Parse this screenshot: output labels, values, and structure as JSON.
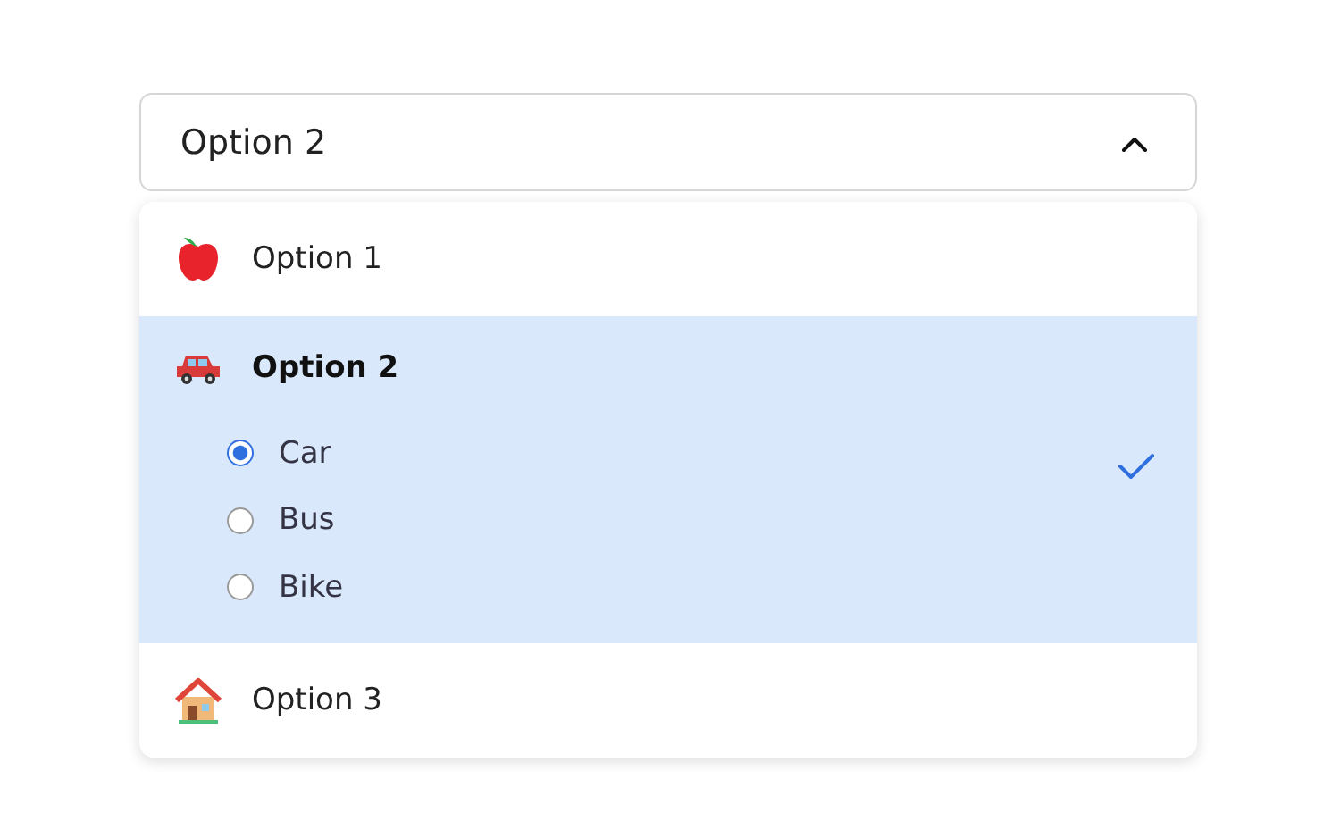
{
  "select": {
    "value": "Option 2",
    "expanded": true
  },
  "options": [
    {
      "label": "Option 1",
      "kind": "apple",
      "selected": false
    },
    {
      "label": "Option 2",
      "kind": "car",
      "selected": true,
      "choices": [
        {
          "label": "Car",
          "selected": true
        },
        {
          "label": "Bus",
          "selected": false
        },
        {
          "label": "Bike",
          "selected": false
        }
      ]
    },
    {
      "label": "Option 3",
      "kind": "house",
      "selected": false
    }
  ]
}
